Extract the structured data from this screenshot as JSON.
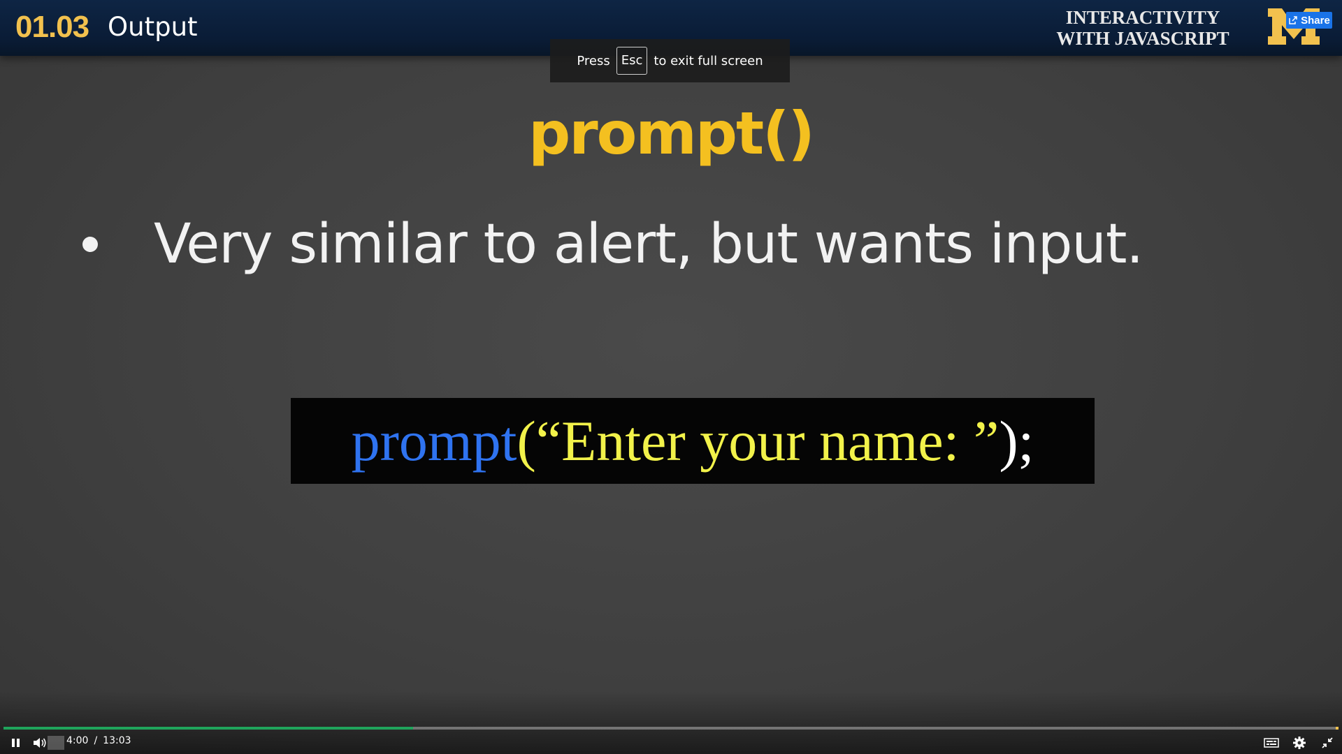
{
  "header": {
    "lesson_number": "01.03",
    "lesson_title": "Output",
    "course_line1": "INTERACTIVITY",
    "course_line2": "WITH JAVASCRIPT",
    "share_label": "Share"
  },
  "fullscreen_notice": {
    "prefix": "Press",
    "key": "Esc",
    "suffix": "to exit full screen"
  },
  "slide": {
    "heading": "prompt()",
    "bullet": "Very similar to alert, but wants input.",
    "code": {
      "function_name": "prompt",
      "string_part": "(“Enter your name: ”",
      "terminator": ");"
    }
  },
  "player": {
    "current_time": "4:00",
    "separator": "/",
    "duration": "13:03",
    "progress": 0.307
  },
  "colors": {
    "header_bg": "#0a1c36",
    "accent_gold": "#f2c14e",
    "heading_yellow": "#f4c020",
    "code_blue": "#2f73f0",
    "code_yellow": "#f2f24a",
    "progress_green": "#1fa45b",
    "share_blue": "#1a73e8"
  },
  "icons": {
    "share": "share-icon",
    "logo": "block-m-logo",
    "pause": "pause-icon",
    "volume": "volume-icon",
    "captions": "captions-icon",
    "settings": "gear-icon",
    "exit_fullscreen": "exit-fullscreen-icon"
  }
}
